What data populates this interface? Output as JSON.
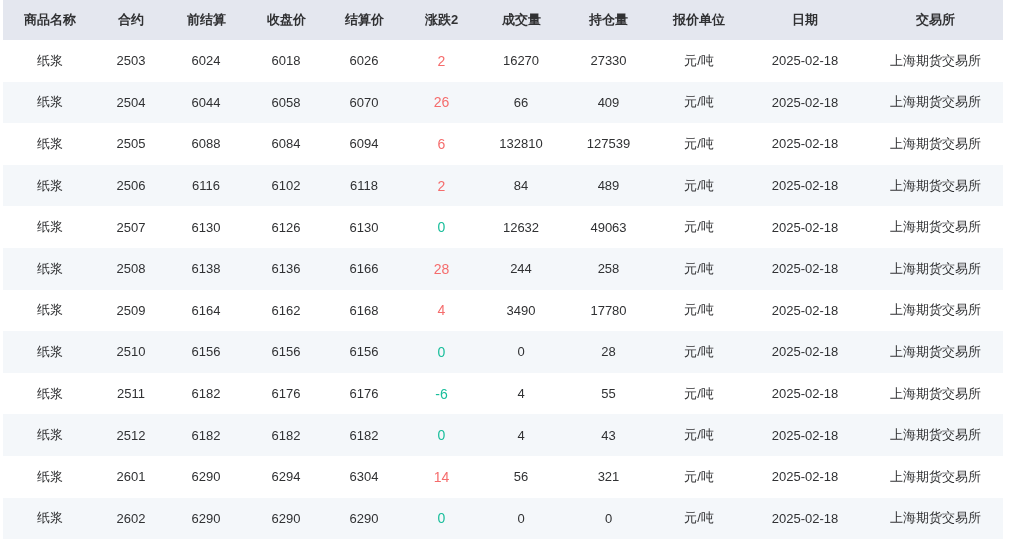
{
  "table": {
    "columns": [
      "商品名称",
      "合约",
      "前结算",
      "收盘价",
      "结算价",
      "涨跌2",
      "成交量",
      "持仓量",
      "报价单位",
      "日期",
      "交易所"
    ],
    "rows": [
      {
        "name": "纸浆",
        "contract": "2503",
        "prev_settle": "6024",
        "close": "6018",
        "settle": "6026",
        "change": {
          "text": "2",
          "color": "#f56c6c"
        },
        "volume": "16270",
        "open_interest": "27330",
        "unit": "元/吨",
        "date": "2025-02-18",
        "exchange": "上海期货交易所"
      },
      {
        "name": "纸浆",
        "contract": "2504",
        "prev_settle": "6044",
        "close": "6058",
        "settle": "6070",
        "change": {
          "text": "26",
          "color": "#f56c6c"
        },
        "volume": "66",
        "open_interest": "409",
        "unit": "元/吨",
        "date": "2025-02-18",
        "exchange": "上海期货交易所"
      },
      {
        "name": "纸浆",
        "contract": "2505",
        "prev_settle": "6088",
        "close": "6084",
        "settle": "6094",
        "change": {
          "text": "6",
          "color": "#f56c6c"
        },
        "volume": "132810",
        "open_interest": "127539",
        "unit": "元/吨",
        "date": "2025-02-18",
        "exchange": "上海期货交易所"
      },
      {
        "name": "纸浆",
        "contract": "2506",
        "prev_settle": "6116",
        "close": "6102",
        "settle": "6118",
        "change": {
          "text": "2",
          "color": "#f56c6c"
        },
        "volume": "84",
        "open_interest": "489",
        "unit": "元/吨",
        "date": "2025-02-18",
        "exchange": "上海期货交易所"
      },
      {
        "name": "纸浆",
        "contract": "2507",
        "prev_settle": "6130",
        "close": "6126",
        "settle": "6130",
        "change": {
          "text": "0",
          "color": "#19be9b"
        },
        "volume": "12632",
        "open_interest": "49063",
        "unit": "元/吨",
        "date": "2025-02-18",
        "exchange": "上海期货交易所"
      },
      {
        "name": "纸浆",
        "contract": "2508",
        "prev_settle": "6138",
        "close": "6136",
        "settle": "6166",
        "change": {
          "text": "28",
          "color": "#f56c6c"
        },
        "volume": "244",
        "open_interest": "258",
        "unit": "元/吨",
        "date": "2025-02-18",
        "exchange": "上海期货交易所"
      },
      {
        "name": "纸浆",
        "contract": "2509",
        "prev_settle": "6164",
        "close": "6162",
        "settle": "6168",
        "change": {
          "text": "4",
          "color": "#f56c6c"
        },
        "volume": "3490",
        "open_interest": "17780",
        "unit": "元/吨",
        "date": "2025-02-18",
        "exchange": "上海期货交易所"
      },
      {
        "name": "纸浆",
        "contract": "2510",
        "prev_settle": "6156",
        "close": "6156",
        "settle": "6156",
        "change": {
          "text": "0",
          "color": "#19be9b"
        },
        "volume": "0",
        "open_interest": "28",
        "unit": "元/吨",
        "date": "2025-02-18",
        "exchange": "上海期货交易所"
      },
      {
        "name": "纸浆",
        "contract": "2511",
        "prev_settle": "6182",
        "close": "6176",
        "settle": "6176",
        "change": {
          "text": "-6",
          "color": "#19be9b"
        },
        "volume": "4",
        "open_interest": "55",
        "unit": "元/吨",
        "date": "2025-02-18",
        "exchange": "上海期货交易所"
      },
      {
        "name": "纸浆",
        "contract": "2512",
        "prev_settle": "6182",
        "close": "6182",
        "settle": "6182",
        "change": {
          "text": "0",
          "color": "#19be9b"
        },
        "volume": "4",
        "open_interest": "43",
        "unit": "元/吨",
        "date": "2025-02-18",
        "exchange": "上海期货交易所"
      },
      {
        "name": "纸浆",
        "contract": "2601",
        "prev_settle": "6290",
        "close": "6294",
        "settle": "6304",
        "change": {
          "text": "14",
          "color": "#f56c6c"
        },
        "volume": "56",
        "open_interest": "321",
        "unit": "元/吨",
        "date": "2025-02-18",
        "exchange": "上海期货交易所"
      },
      {
        "name": "纸浆",
        "contract": "2602",
        "prev_settle": "6290",
        "close": "6290",
        "settle": "6290",
        "change": {
          "text": "0",
          "color": "#19be9b"
        },
        "volume": "0",
        "open_interest": "0",
        "unit": "元/吨",
        "date": "2025-02-18",
        "exchange": "上海期货交易所"
      }
    ]
  }
}
